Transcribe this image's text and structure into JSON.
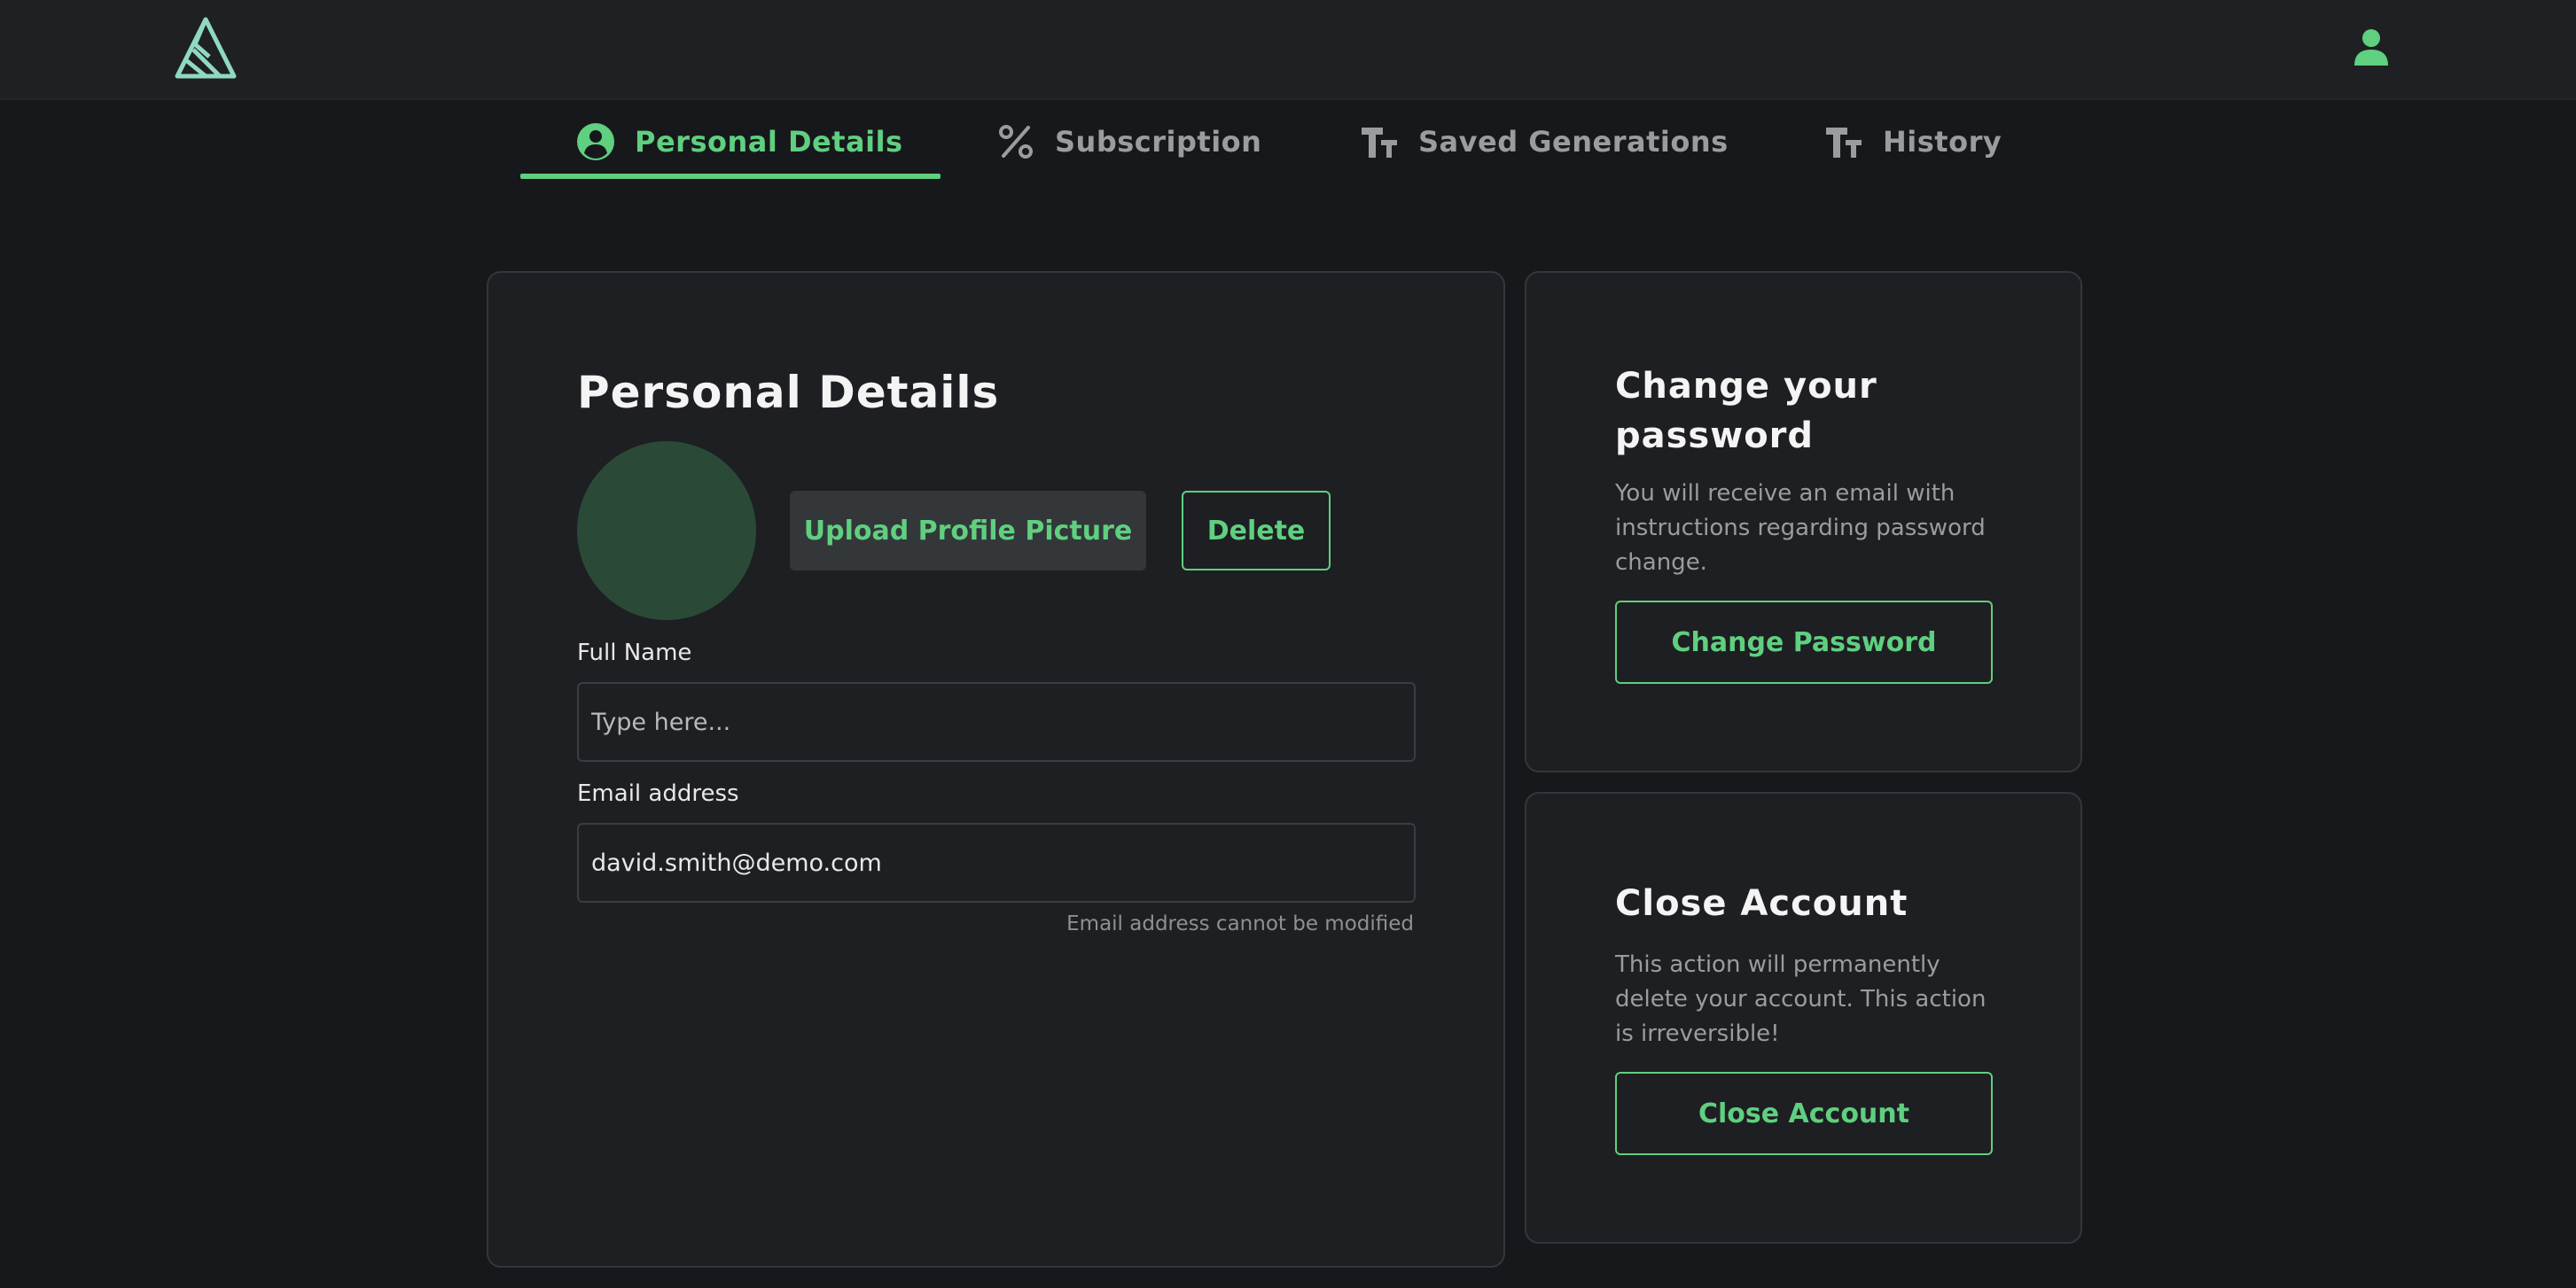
{
  "header": {
    "logo_icon": "triangle-logo-icon",
    "user_icon": "user-icon"
  },
  "tabs": [
    {
      "label": "Personal Details",
      "icon": "user-circle-icon",
      "active": true
    },
    {
      "label": "Subscription",
      "icon": "percent-icon",
      "active": false
    },
    {
      "label": "Saved Generations",
      "icon": "text-size-icon",
      "active": false
    },
    {
      "label": "History",
      "icon": "text-size-icon",
      "active": false
    }
  ],
  "personal": {
    "title": "Personal Details",
    "upload_label": "Upload Profile Picture",
    "delete_label": "Delete",
    "full_name_label": "Full Name",
    "full_name_placeholder": "Type here...",
    "full_name_value": "",
    "email_label": "Email address",
    "email_value": "david.smith@demo.com",
    "email_hint": "Email address cannot be modified"
  },
  "password": {
    "title": "Change your password",
    "description": "You will receive an email with instructions regarding password change.",
    "button_label": "Change Password"
  },
  "close_account": {
    "title": "Close Account",
    "description": "This action will permanently delete your account. This action is irreversible!",
    "button_label": "Close Account"
  },
  "colors": {
    "accent": "#5fcf80",
    "background": "#17181b",
    "card": "#1e1f22",
    "avatar": "#2a4a37"
  }
}
